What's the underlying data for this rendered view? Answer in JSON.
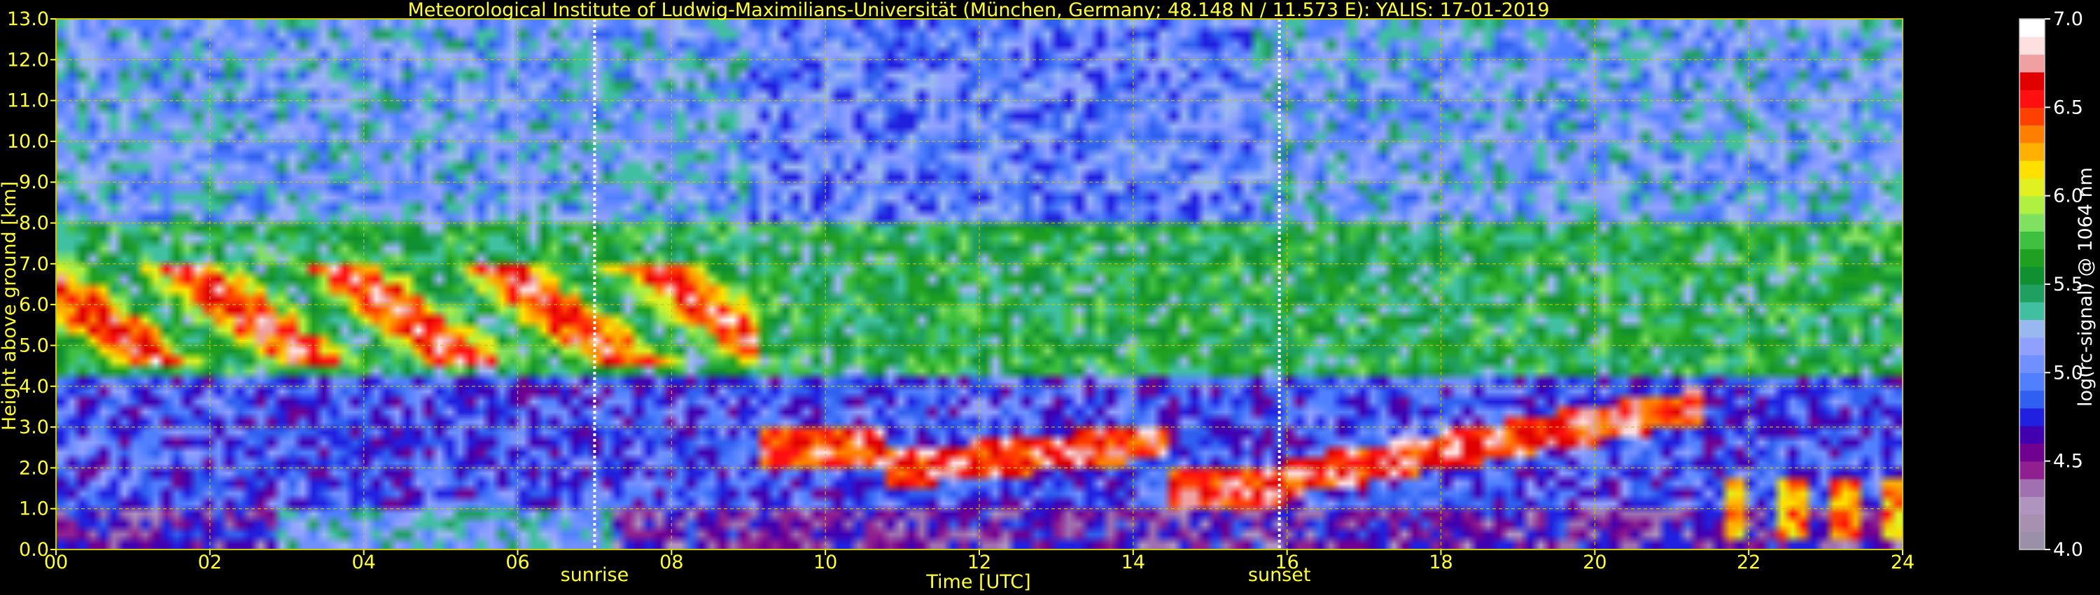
{
  "chart_data": {
    "type": "heatmap",
    "title": "Meteorological Institute of Ludwig-Maximilians-Universität (München, Germany; 48.148 N / 11.573 E):    YALIS: 17-01-2019",
    "xlabel": "Time [UTC]",
    "ylabel": "Height above ground [km]",
    "xlim": [
      0,
      24
    ],
    "ylim": [
      0,
      13
    ],
    "x_ticks": [
      "00",
      "02",
      "04",
      "06",
      "08",
      "10",
      "12",
      "14",
      "16",
      "18",
      "20",
      "22",
      "24"
    ],
    "y_ticks": [
      "0.0",
      "1.0",
      "2.0",
      "3.0",
      "4.0",
      "5.0",
      "6.0",
      "7.0",
      "8.0",
      "9.0",
      "10.0",
      "11.0",
      "12.0",
      "13.0"
    ],
    "grid": true,
    "markers": [
      {
        "label": "sunrise",
        "x": 7.0
      },
      {
        "label": "sunset",
        "x": 15.9
      }
    ],
    "colorbar": {
      "label": "log(rc-signal) @ 1064 nm",
      "range": [
        4.0,
        7.0
      ],
      "ticks": [
        "4.0",
        "4.5",
        "5.0",
        "5.5",
        "6.0",
        "6.5",
        "7.0"
      ],
      "colors": [
        "#9a90a8",
        "#a890b0",
        "#b094c0",
        "#a070b0",
        "#902090",
        "#700090",
        "#4000b0",
        "#2020e0",
        "#3060f0",
        "#5080ff",
        "#7090ff",
        "#90a0ff",
        "#9ab8f0",
        "#40c0a0",
        "#20a060",
        "#109030",
        "#20a020",
        "#40c040",
        "#80e060",
        "#b0f040",
        "#e0f020",
        "#ffe000",
        "#ffb000",
        "#ff8000",
        "#ff4000",
        "#ff1010",
        "#e00000",
        "#f0a0a0",
        "#ffe0e0",
        "#ffffff"
      ]
    },
    "features": [
      {
        "name": "boundary-layer",
        "t": [
          0,
          24
        ],
        "h": [
          0,
          0.95
        ]
      },
      {
        "name": "aerosol-blue",
        "t": [
          2.8,
          7.2
        ],
        "h": [
          0,
          0.9
        ]
      },
      {
        "name": "cirrus",
        "t": [
          0,
          9.1
        ],
        "h": [
          4.6,
          7.1
        ]
      },
      {
        "name": "cloud-layer",
        "t": [
          9.1,
          21.4
        ],
        "h": [
          1.2,
          4.0
        ]
      },
      {
        "name": "low-cloud",
        "t": [
          21.5,
          24
        ],
        "h": [
          0.3,
          2.0
        ]
      }
    ]
  }
}
